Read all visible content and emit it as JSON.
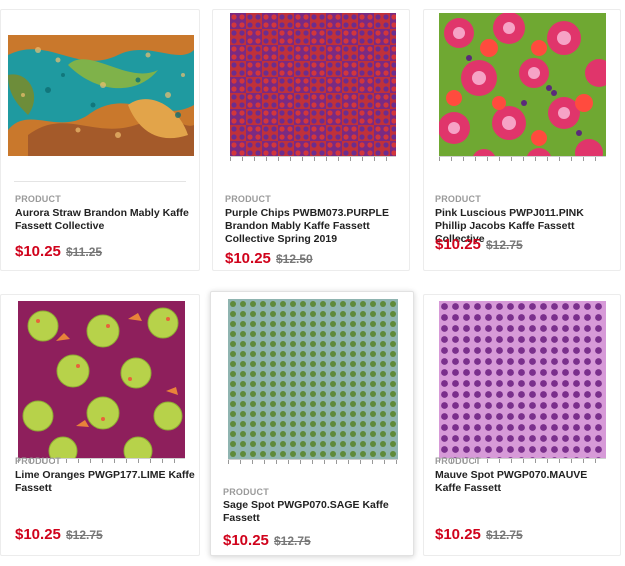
{
  "products": [
    {
      "kind": "PRODUCT",
      "title": "Aurora Straw Brandon Mably Kaffe Fassett Collective",
      "price": "$10.25",
      "was": "$11.25",
      "swatch": "aurora"
    },
    {
      "kind": "PRODUCT",
      "title": "Purple Chips PWBM073.PURPLE Brandon Mably Kaffe Fassett Collective Spring 2019",
      "price": "$10.25",
      "was": "$12.50",
      "swatch": "purple-chips"
    },
    {
      "kind": "PRODUCT",
      "title": "Pink Luscious PWPJ011.PINK Phillip Jacobs Kaffe Fassett Collective",
      "price": "$10.25",
      "was": "$12.75",
      "swatch": "pink-luscious"
    },
    {
      "kind": "PRODUCT",
      "title": "Lime Oranges PWGP177.LIME Kaffe Fassett",
      "price": "$10.25",
      "was": "$12.75",
      "swatch": "lime-oranges"
    },
    {
      "kind": "PRODUCT",
      "title": "Sage Spot PWGP070.SAGE Kaffe Fassett",
      "price": "$10.25",
      "was": "$12.75",
      "swatch": "sage-spot"
    },
    {
      "kind": "PRODUCT",
      "title": "Mauve Spot PWGP070.MAUVE Kaffe Fassett",
      "price": "$10.25",
      "was": "$12.75",
      "swatch": "mauve-spot"
    }
  ],
  "colors": {
    "price": "#d0021b",
    "purple_bg": "#c0313a",
    "purple_dot": "#6b2d8f",
    "pink_bg": "#6fa832",
    "lime_bg": "#8e1f5c",
    "lime_fruit": "#b7d24a",
    "sage_bg": "#8fb4b0",
    "sage_dot": "#5f8a3a",
    "mauve_bg": "#d79ad8",
    "mauve_dot": "#7a2f8c"
  }
}
